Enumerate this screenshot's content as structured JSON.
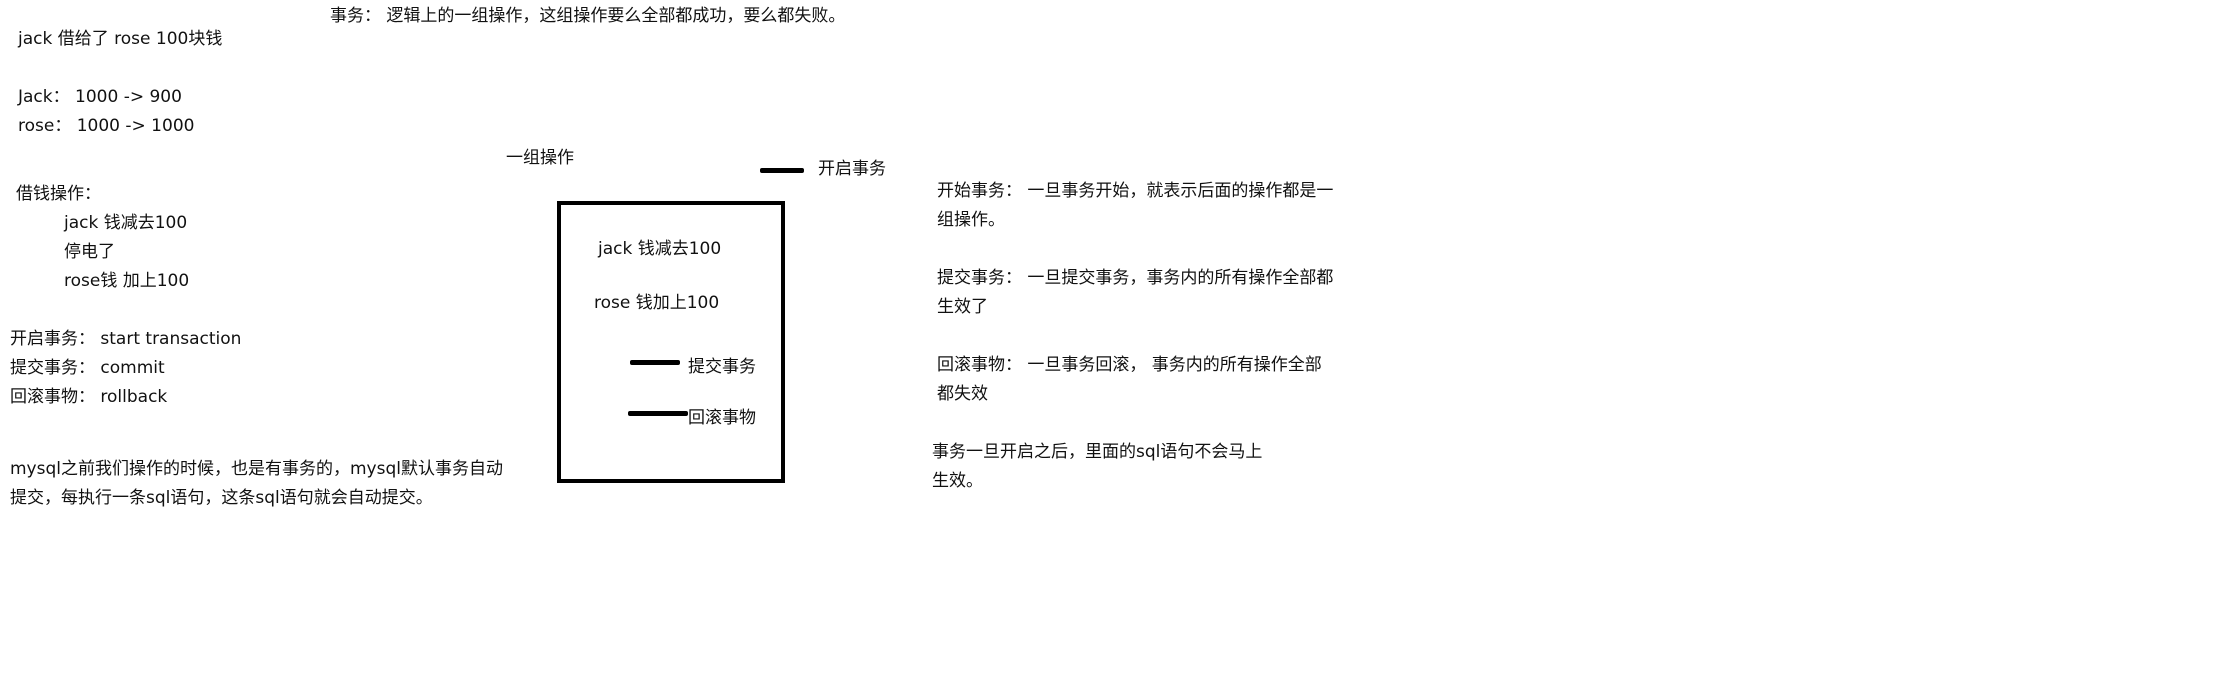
{
  "colors": {
    "text": "#111111",
    "lines": "#000000",
    "background": "#ffffff"
  },
  "header": {
    "definition": "事务： 逻辑上的一组操作，这组操作要么全部都成功，要么都失败。"
  },
  "left": {
    "scenario": "jack 借给了 rose  100块钱",
    "jack_balance": "Jack： 1000  -> 900",
    "rose_balance": "rose： 1000  -> 1000",
    "borrow_title": "借钱操作：",
    "steps": [
      "jack 钱减去100",
      "停电了",
      "rose钱 加上100"
    ],
    "commands": [
      "开启事务：  start transaction",
      "提交事务：  commit",
      "回滚事物：  rollback"
    ],
    "note": [
      "mysql之前我们操作的时候，也是有事务的，mysql默认事务自动",
      "提交，每执行一条sql语句，这条sql语句就会自动提交。"
    ]
  },
  "diagram": {
    "group_label": "一组操作",
    "start_label": "开启事务",
    "op1": "jack 钱减去100",
    "op2": "rose  钱加上100",
    "commit_label": "提交事务",
    "rollback_label": "回滚事物"
  },
  "right": {
    "start": [
      "开始事务：  一旦事务开始，就表示后面的操作都是一",
      "组操作。"
    ],
    "commit": [
      "提交事务：  一旦提交事务，事务内的所有操作全部都",
      "生效了"
    ],
    "rollback": [
      "回滚事物：  一旦事务回滚，  事务内的所有操作全部",
      "都失效"
    ],
    "effect": [
      "事务一旦开启之后，里面的sql语句不会马上",
      "生效。"
    ]
  }
}
